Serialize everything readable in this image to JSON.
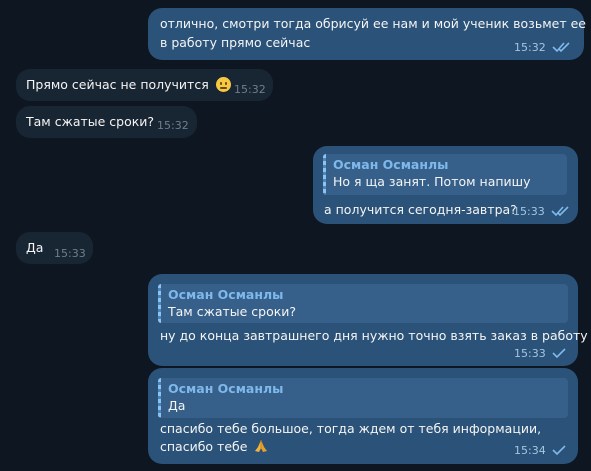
{
  "chat": {
    "messages": [
      {
        "direction": "out",
        "lines": [
          "отлично, смотри тогда обрисуй ее нам и мой ученик возьмет ее",
          "в работу прямо сейчас"
        ],
        "time": "15:32",
        "status": "read"
      },
      {
        "direction": "in",
        "lines": [
          "Прямо сейчас не получится"
        ],
        "emoji": "face-with-diagonal-mouth-icon",
        "time": "15:32"
      },
      {
        "direction": "in",
        "lines": [
          "Там сжатые сроки?"
        ],
        "time": "15:32"
      },
      {
        "direction": "out",
        "reply": {
          "author": "Осман Османлы",
          "text": "Но я ща занят. Потом напишу"
        },
        "lines": [
          "а получится сегодня-завтра?"
        ],
        "time": "15:33",
        "status": "read"
      },
      {
        "direction": "in",
        "lines": [
          "Да"
        ],
        "time": "15:33"
      },
      {
        "direction": "out",
        "reply": {
          "author": "Осман Османлы",
          "text": "Там сжатые сроки?"
        },
        "lines": [
          "ну до конца завтрашнего дня нужно точно взять заказ в работу"
        ],
        "time": "15:33",
        "status": "sent"
      },
      {
        "direction": "out",
        "reply": {
          "author": "Осман Османлы",
          "text": "Да"
        },
        "lines": [
          "спасибо тебе большое, тогда ждем от тебя информации,",
          "спасибо тебе"
        ],
        "emoji": "folded-hands-icon",
        "time": "15:34",
        "status": "sent"
      }
    ]
  },
  "colors": {
    "background": "#0e1621",
    "outgoing_bubble": "#2b5278",
    "incoming_bubble": "#182533",
    "reply_author": "#7fb9ec"
  }
}
